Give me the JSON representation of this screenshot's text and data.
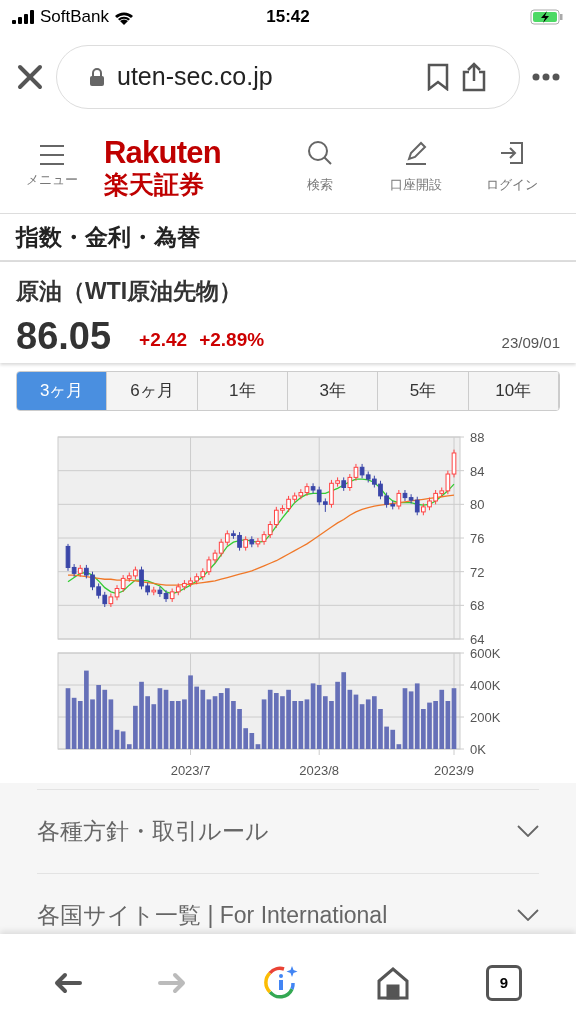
{
  "status_bar": {
    "carrier": "SoftBank",
    "time": "15:42"
  },
  "browser": {
    "url": "uten-sec.co.jp"
  },
  "site_header": {
    "logo_en": "Rakuten",
    "logo_ja": "楽天証券",
    "menu": "メニュー",
    "actions": [
      {
        "kind": "search",
        "label": "検索"
      },
      {
        "kind": "account",
        "label": "口座開設"
      },
      {
        "kind": "login",
        "label": "ログイン"
      }
    ]
  },
  "section_title": "指数・金利・為替",
  "instrument": {
    "name": "原油（WTI原油先物）",
    "price": "86.05",
    "change": "+2.42",
    "change_pct": "+2.89%",
    "date": "23/09/01"
  },
  "period_tabs": [
    {
      "label": "3ヶ月",
      "selected": true
    },
    {
      "label": "6ヶ月",
      "selected": false
    },
    {
      "label": "1年",
      "selected": false
    },
    {
      "label": "3年",
      "selected": false
    },
    {
      "label": "5年",
      "selected": false
    },
    {
      "label": "10年",
      "selected": false
    }
  ],
  "price_chart": {
    "chart_data": {
      "type": "candlestick",
      "grid": true,
      "ylim": [
        64,
        88
      ],
      "yticks": [
        {
          "value": 64,
          "label": "64"
        },
        {
          "value": 68,
          "label": "68"
        },
        {
          "value": 72,
          "label": "72"
        },
        {
          "value": 76,
          "label": "76"
        },
        {
          "value": 80,
          "label": "80"
        },
        {
          "value": 84,
          "label": "84"
        },
        {
          "value": 88,
          "label": "88"
        }
      ],
      "categories": [
        null,
        null,
        null,
        null,
        null,
        null,
        null,
        null,
        null,
        null,
        null,
        null,
        null,
        null,
        null,
        null,
        null,
        null,
        null,
        null,
        null,
        null,
        null,
        null,
        null,
        null,
        null,
        null,
        null,
        null,
        null,
        null,
        null,
        null,
        null,
        null,
        null,
        null,
        null,
        null,
        null,
        null,
        null,
        null,
        null,
        null,
        null,
        null,
        null,
        null,
        null,
        null,
        null,
        null,
        null,
        null,
        null,
        null,
        null,
        null,
        null,
        null,
        null,
        null
      ],
      "ohlc": [
        [
          75.0,
          75.3,
          72.1,
          72.5
        ],
        [
          72.5,
          72.9,
          71.4,
          71.8
        ],
        [
          71.8,
          72.8,
          71.4,
          72.4
        ],
        [
          72.4,
          72.8,
          71.2,
          71.6
        ],
        [
          71.6,
          72.0,
          69.8,
          70.2
        ],
        [
          70.2,
          70.6,
          68.8,
          69.2
        ],
        [
          69.2,
          69.6,
          67.8,
          68.2
        ],
        [
          68.2,
          69.4,
          67.8,
          69.0
        ],
        [
          69.0,
          70.4,
          68.6,
          70.0
        ],
        [
          70.0,
          71.6,
          69.6,
          71.2
        ],
        [
          71.2,
          71.9,
          70.8,
          71.5
        ],
        [
          71.5,
          72.6,
          71.1,
          72.2
        ],
        [
          72.2,
          72.6,
          69.9,
          70.3
        ],
        [
          70.3,
          70.7,
          69.2,
          69.6
        ],
        [
          69.6,
          70.2,
          69.2,
          69.8
        ],
        [
          69.8,
          70.2,
          69.0,
          69.4
        ],
        [
          69.4,
          69.8,
          68.4,
          68.8
        ],
        [
          68.8,
          70.0,
          68.4,
          69.6
        ],
        [
          69.6,
          70.6,
          69.2,
          70.2
        ],
        [
          70.2,
          71.0,
          69.8,
          70.6
        ],
        [
          70.6,
          71.3,
          70.2,
          70.9
        ],
        [
          70.9,
          71.8,
          70.5,
          71.4
        ],
        [
          71.4,
          72.4,
          71.0,
          72.0
        ],
        [
          72.0,
          73.8,
          71.6,
          73.4
        ],
        [
          73.4,
          74.6,
          73.0,
          74.2
        ],
        [
          74.2,
          75.9,
          73.8,
          75.5
        ],
        [
          75.5,
          76.9,
          75.1,
          76.5
        ],
        [
          76.5,
          76.9,
          75.9,
          76.3
        ],
        [
          76.3,
          76.7,
          74.5,
          74.9
        ],
        [
          74.9,
          76.2,
          74.5,
          75.8
        ],
        [
          75.8,
          76.2,
          74.9,
          75.3
        ],
        [
          75.3,
          76.0,
          74.9,
          75.6
        ],
        [
          75.6,
          76.8,
          75.2,
          76.4
        ],
        [
          76.4,
          78.0,
          76.0,
          77.6
        ],
        [
          77.6,
          79.7,
          77.2,
          79.3
        ],
        [
          79.3,
          79.9,
          78.9,
          79.5
        ],
        [
          79.5,
          81.0,
          79.1,
          80.6
        ],
        [
          80.6,
          81.4,
          80.2,
          81.0
        ],
        [
          81.0,
          81.8,
          80.6,
          81.4
        ],
        [
          81.4,
          82.5,
          81.0,
          82.1
        ],
        [
          82.1,
          82.5,
          81.3,
          81.7
        ],
        [
          81.7,
          82.1,
          79.9,
          80.3
        ],
        [
          80.3,
          80.7,
          79.1,
          80.0
        ],
        [
          80.0,
          82.9,
          79.6,
          82.5
        ],
        [
          82.5,
          83.2,
          82.1,
          82.8
        ],
        [
          82.8,
          83.2,
          81.6,
          82.0
        ],
        [
          82.0,
          83.6,
          81.6,
          83.2
        ],
        [
          83.2,
          84.8,
          82.8,
          84.4
        ],
        [
          84.4,
          84.8,
          83.1,
          83.5
        ],
        [
          83.5,
          83.9,
          82.6,
          83.0
        ],
        [
          83.0,
          83.4,
          82.0,
          82.4
        ],
        [
          82.4,
          82.8,
          80.6,
          81.0
        ],
        [
          81.0,
          81.4,
          79.6,
          80.0
        ],
        [
          80.0,
          80.4,
          79.4,
          79.8
        ],
        [
          79.8,
          81.7,
          79.4,
          81.3
        ],
        [
          81.3,
          81.7,
          80.4,
          80.8
        ],
        [
          80.8,
          81.2,
          80.1,
          80.5
        ],
        [
          80.5,
          80.9,
          78.7,
          79.1
        ],
        [
          79.1,
          80.1,
          78.7,
          79.7
        ],
        [
          79.7,
          80.8,
          79.3,
          80.4
        ],
        [
          80.4,
          81.7,
          80.0,
          81.3
        ],
        [
          81.3,
          82.0,
          80.9,
          81.6
        ],
        [
          81.6,
          84.0,
          81.2,
          83.6
        ],
        [
          83.6,
          86.5,
          83.2,
          86.1
        ]
      ],
      "series": [
        {
          "type": "line",
          "color": "#33cc33",
          "values": [
            70.8,
            71.3,
            71.8,
            71.9,
            71.6,
            70.9,
            70.1,
            69.6,
            69.4,
            69.7,
            70.4,
            71.0,
            71.0,
            70.9,
            70.6,
            70.3,
            69.6,
            69.4,
            69.6,
            70.0,
            70.4,
            70.9,
            71.4,
            72.2,
            73.0,
            74.0,
            75.0,
            75.5,
            75.7,
            75.8,
            75.6,
            75.5,
            75.6,
            76.4,
            77.4,
            78.4,
            79.3,
            80.2,
            80.8,
            81.2,
            81.3,
            81.3,
            81.3,
            81.6,
            81.9,
            82.3,
            82.7,
            83.0,
            83.0,
            82.9,
            82.6,
            81.9,
            81.0,
            80.4,
            80.2,
            80.2,
            80.2,
            80.0,
            79.9,
            80.0,
            80.4,
            81.0,
            81.6,
            82.4
          ]
        },
        {
          "type": "line",
          "color": "#f07828",
          "values": [
            71.6,
            71.6,
            71.5,
            71.4,
            71.3,
            71.2,
            71.1,
            71.1,
            71.0,
            71.0,
            71.0,
            70.9,
            70.8,
            70.7,
            70.6,
            70.5,
            70.4,
            70.4,
            70.4,
            70.5,
            70.5,
            70.6,
            70.7,
            70.8,
            70.9,
            71.1,
            71.3,
            71.5,
            71.7,
            71.9,
            72.1,
            72.4,
            72.7,
            73.0,
            73.3,
            73.7,
            74.1,
            74.5,
            74.9,
            75.3,
            75.8,
            76.3,
            76.8,
            77.3,
            77.8,
            78.2,
            78.7,
            79.1,
            79.4,
            79.6,
            79.8,
            79.9,
            80.0,
            80.1,
            80.2,
            80.3,
            80.4,
            80.5,
            80.6,
            80.7,
            80.8,
            80.9,
            81.0,
            81.1
          ]
        }
      ]
    }
  },
  "volume_chart": {
    "chart_data": {
      "type": "bar",
      "grid": true,
      "ylim": [
        0,
        600
      ],
      "yticks": [
        {
          "value": 0,
          "label": "0K"
        },
        {
          "value": 200,
          "label": "200K"
        },
        {
          "value": 400,
          "label": "400K"
        },
        {
          "value": 600,
          "label": "600K"
        }
      ],
      "categories": [
        null,
        null,
        null,
        null,
        null,
        null,
        null,
        null,
        null,
        null,
        null,
        null,
        null,
        null,
        null,
        null,
        null,
        null,
        null,
        null,
        "2023/7",
        null,
        null,
        null,
        null,
        null,
        null,
        null,
        null,
        null,
        null,
        null,
        null,
        null,
        null,
        null,
        null,
        null,
        null,
        null,
        null,
        "2023/8",
        null,
        null,
        null,
        null,
        null,
        null,
        null,
        null,
        null,
        null,
        null,
        null,
        null,
        null,
        null,
        null,
        null,
        null,
        null,
        null,
        null,
        "2023/9"
      ],
      "series": [
        {
          "color": "#6670b8",
          "values": [
            380,
            320,
            300,
            490,
            310,
            400,
            370,
            310,
            120,
            110,
            30,
            270,
            420,
            330,
            280,
            380,
            370,
            300,
            300,
            310,
            460,
            390,
            370,
            310,
            330,
            350,
            380,
            300,
            250,
            130,
            100,
            30,
            310,
            370,
            350,
            330,
            370,
            300,
            300,
            310,
            410,
            400,
            330,
            300,
            420,
            480,
            370,
            340,
            280,
            310,
            330,
            250,
            140,
            120,
            30,
            380,
            360,
            410,
            250,
            290,
            300,
            370,
            300,
            380
          ]
        }
      ]
    }
  },
  "footer_links": [
    {
      "label": "各種方針・取引ルール",
      "expanded": false
    },
    {
      "label": "各国サイト一覧 | For International",
      "expanded": false
    }
  ],
  "bottom_bar": {
    "tab_count": "9"
  }
}
